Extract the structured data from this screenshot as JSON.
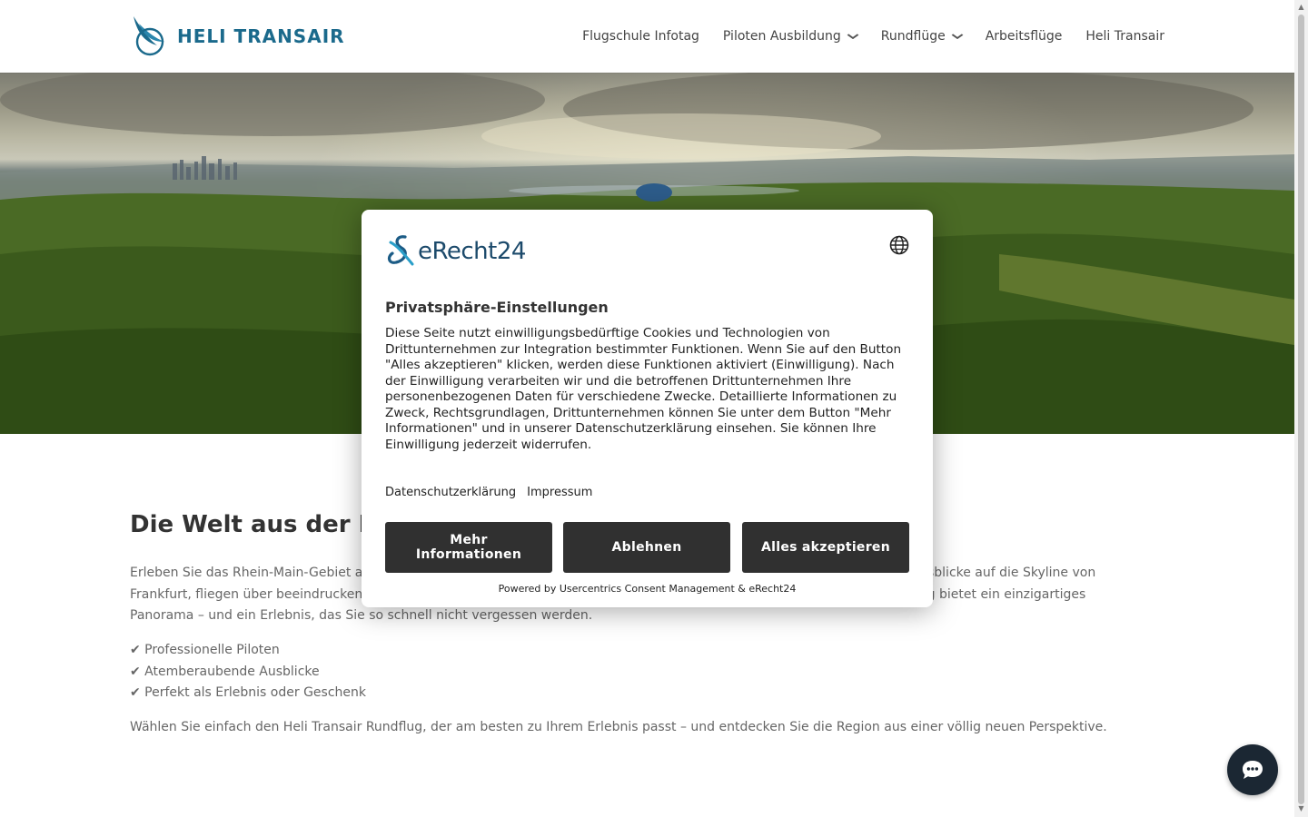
{
  "header": {
    "logo_text": "HELI TRANSAIR",
    "nav": [
      {
        "label": "Flugschule Infotag",
        "has_dropdown": false
      },
      {
        "label": "Piloten Ausbildung",
        "has_dropdown": true
      },
      {
        "label": "Rundflüge",
        "has_dropdown": true
      },
      {
        "label": "Arbeitsflüge",
        "has_dropdown": false
      },
      {
        "label": "Heli Transair",
        "has_dropdown": false
      }
    ],
    "chevron": "⌄"
  },
  "main": {
    "heading": "Die Welt aus der Luft",
    "intro": "Erleben Sie das Rhein-Main-Gebiet aus einer völlig neuen Perspektive. Bei unseren Rundflügen genießen Sie spektakuläre Ausblicke auf die Skyline von Frankfurt, fliegen über beeindruckende Landschaften, malerische Flussläufe und bis in die Weinberge in den Süden. Jeder Flug bietet ein einzigartiges Panorama – und ein Erlebnis, das Sie so schnell nicht vergessen werden.",
    "features": [
      "✔ Professionelle Piloten",
      "✔ Atemberaubende Ausblicke",
      "✔ Perfekt als Erlebnis oder Geschenk"
    ],
    "closing": "Wählen Sie einfach den Heli Transair Rundflug, der am besten zu Ihrem Erlebnis passt – und entdecken Sie die Region aus einer völlig neuen Perspektive."
  },
  "consent": {
    "brand": "eRecht24",
    "title": "Privatsphäre-Einstellungen",
    "body": "Diese Seite nutzt einwilligungsbedürftige Cookies und Technologien von Drittunternehmen zur Integration bestimmter Funktionen. Wenn Sie auf den Button \"Alles akzeptieren\" klicken, werden diese Funktionen aktiviert (Einwilligung). Nach der Einwilligung verarbeiten wir und die betroffenen Drittunternehmen Ihre personenbezogenen Daten für verschiedene Zwecke. Detaillierte Informationen zu Zweck, Rechtsgrundlagen, Drittunternehmen können Sie unter dem Button \"Mehr Informationen\" und in unserer Datenschutzerklärung einsehen. Sie können Ihre Einwilligung jederzeit widerrufen.",
    "link_privacy": "Datenschutzerklärung",
    "link_imprint": "Impressum",
    "btn_more": "Mehr Informationen",
    "btn_deny": "Ablehnen",
    "btn_accept": "Alles akzeptieren",
    "powered_by": "Powered by Usercentrics Consent Management & eRecht24"
  },
  "colors": {
    "brand_blue": "#1b6a8c",
    "button_dark": "#303030",
    "chat_bg": "#1b2733"
  },
  "icons": {
    "globe": "globe-icon",
    "chat": "chat-icon",
    "logo": "heli-wing-logo-icon"
  }
}
